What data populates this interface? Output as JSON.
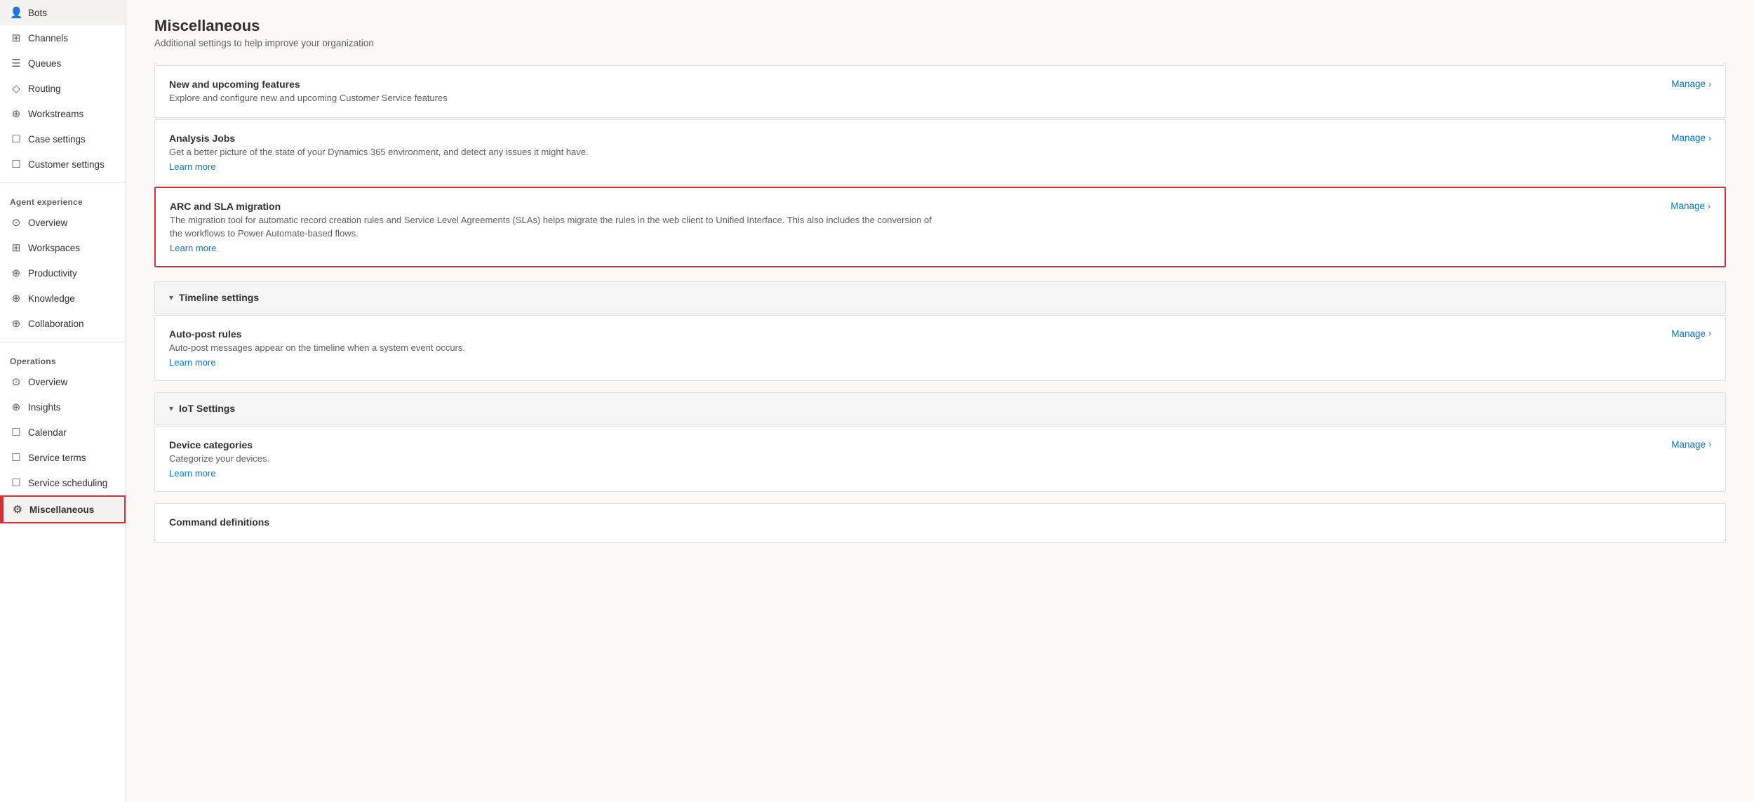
{
  "sidebar": {
    "items_top": [
      {
        "id": "bots",
        "label": "Bots",
        "icon": "👤"
      },
      {
        "id": "channels",
        "label": "Channels",
        "icon": "⊞"
      },
      {
        "id": "queues",
        "label": "Queues",
        "icon": "☰"
      },
      {
        "id": "routing",
        "label": "Routing",
        "icon": "◇"
      },
      {
        "id": "workstreams",
        "label": "Workstreams",
        "icon": "⊕"
      },
      {
        "id": "case-settings",
        "label": "Case settings",
        "icon": "☐"
      },
      {
        "id": "customer-settings",
        "label": "Customer settings",
        "icon": "☐"
      }
    ],
    "agent_experience_label": "Agent experience",
    "items_agent": [
      {
        "id": "overview-agent",
        "label": "Overview",
        "icon": "⊙"
      },
      {
        "id": "workspaces",
        "label": "Workspaces",
        "icon": "⊞"
      },
      {
        "id": "productivity",
        "label": "Productivity",
        "icon": "⊕"
      },
      {
        "id": "knowledge",
        "label": "Knowledge",
        "icon": "⊕"
      },
      {
        "id": "collaboration",
        "label": "Collaboration",
        "icon": "⊕"
      }
    ],
    "operations_label": "Operations",
    "items_operations": [
      {
        "id": "overview-ops",
        "label": "Overview",
        "icon": "⊙"
      },
      {
        "id": "insights",
        "label": "Insights",
        "icon": "⊕"
      },
      {
        "id": "calendar",
        "label": "Calendar",
        "icon": "☐"
      },
      {
        "id": "service-terms",
        "label": "Service terms",
        "icon": "☐"
      },
      {
        "id": "service-scheduling",
        "label": "Service scheduling",
        "icon": "☐"
      },
      {
        "id": "miscellaneous",
        "label": "Miscellaneous",
        "icon": "⚙"
      }
    ]
  },
  "main": {
    "title": "Miscellaneous",
    "subtitle": "Additional settings to help improve your organization",
    "sections": {
      "new_upcoming": {
        "title": "New and upcoming features",
        "description": "Explore and configure new and upcoming Customer Service features",
        "manage_label": "Manage"
      },
      "analysis_jobs": {
        "title": "Analysis Jobs",
        "description": "Get a better picture of the state of your Dynamics 365 environment, and detect any issues it might have.",
        "learn_more": "Learn more",
        "manage_label": "Manage"
      },
      "arc_sla": {
        "title": "ARC and SLA migration",
        "description": "The migration tool for automatic record creation rules and Service Level Agreements (SLAs) helps migrate the rules in the web client to Unified Interface. This also includes the conversion of the workflows to Power Automate-based flows.",
        "learn_more": "Learn more",
        "manage_label": "Manage"
      },
      "timeline_settings": {
        "label": "Timeline settings",
        "auto_post_rules": {
          "title": "Auto-post rules",
          "description": "Auto-post messages appear on the timeline when a system event occurs.",
          "learn_more": "Learn more",
          "manage_label": "Manage"
        }
      },
      "iot_settings": {
        "label": "IoT Settings",
        "device_categories": {
          "title": "Device categories",
          "description": "Categorize your devices.",
          "learn_more": "Learn more",
          "manage_label": "Manage"
        }
      },
      "command_definitions": {
        "title": "Command definitions"
      }
    }
  }
}
